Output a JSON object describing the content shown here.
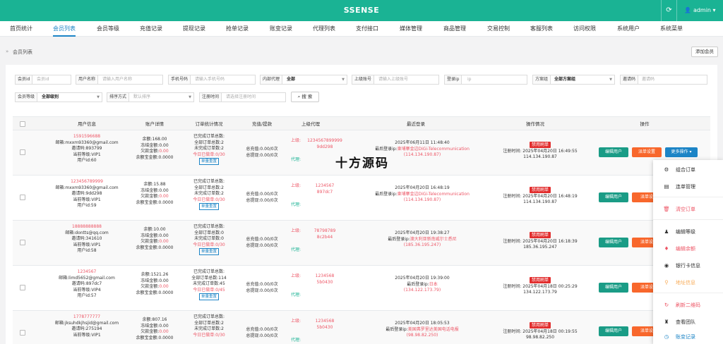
{
  "app": {
    "title": "SSENSE",
    "user": "admin"
  },
  "nav": [
    "首页统计",
    "会员列表",
    "会员等级",
    "充值记录",
    "提现记录",
    "抢单记录",
    "账变记录",
    "代理列表",
    "支付接口",
    "媒体管理",
    "商品管理",
    "交易控制",
    "客服列表",
    "访问权限",
    "系统用户",
    "系统菜单"
  ],
  "breadcrumb": {
    "label": "会员列表",
    "add_button": "添加会员"
  },
  "filters": {
    "userid": {
      "label": "会员id",
      "placeholder": "会员id"
    },
    "username": {
      "label": "用户名称",
      "placeholder": "请输入用户名称"
    },
    "phone": {
      "label": "手机号码",
      "placeholder": "请输入手机号码"
    },
    "agent": {
      "label": "内部代理",
      "value": "全部"
    },
    "superior": {
      "label": "上级账号",
      "placeholder": "请输入上级账号"
    },
    "ip": {
      "label": "登录ip",
      "placeholder": "ip"
    },
    "scheme": {
      "label": "方案组",
      "value": "全部方案组"
    },
    "invite": {
      "label": "邀请码",
      "placeholder": "邀请码"
    },
    "level": {
      "label": "会员等级",
      "value": "全部级别"
    },
    "sort": {
      "label": "排序方式",
      "placeholder": "默认排序"
    },
    "regtime": {
      "label": "注册时间",
      "placeholder": "请选择注册时间"
    },
    "search_button": "搜 索"
  },
  "table": {
    "headers": [
      "用户信息",
      "账户详情",
      "订单统计情况",
      "充值/提款",
      "上级代理",
      "最近登录",
      "操作情况",
      "操作"
    ],
    "rows": [
      {
        "phone": "1591596688",
        "email": "邮箱:mxxm93360@gmail.com",
        "invite": "邀请码:893799",
        "level": "当前等级:VIP1",
        "pid": "用户id:60",
        "balance": "余额:168.00",
        "frozen": "冻结金额:0.00",
        "owed_label": "欠款金额:",
        "owed_val": "0.00",
        "yeb": "余额宝金额:0.0000",
        "o1": "已完成订单总数:",
        "o2": "全部订单总数:2",
        "o3": "未完成订单数:2",
        "o4": "今日已做单:0/30",
        "o5": "单量重置",
        "dep": "总充值:0.00/0次",
        "wd": "总提现:0.00/0次",
        "sup_label": "上级:",
        "sup_val": "1234567899999\n9dd298",
        "agent_label": "代理:",
        "l1": "2025年06月11日 11:48:40",
        "l2_label": "最后登录ip:",
        "l2_val": "柬埔寨金边DiGi-Telecommunication",
        "l3": "(114.134.190.87)",
        "ban": "禁用刷单",
        "reg": "注册时间: 2025年04月20日 16:49:55",
        "ip": "114.134.190.87",
        "edit": "编辑用户",
        "setting": "派单设置",
        "more": "更多操作 ▾"
      },
      {
        "phone": "123456789999",
        "email": "邮箱:mxxm93360@gmail.com",
        "invite": "邀请码:9dd298",
        "level": "当前等级:VIP1",
        "pid": "用户id:59",
        "balance": "余额:15.88",
        "frozen": "冻结金额:0.00",
        "owed_label": "欠款金额:",
        "owed_val": "0.00",
        "yeb": "余额宝金额:0.0000",
        "o1": "已完成订单总数:",
        "o2": "全部订单总数:2",
        "o3": "未完成订单数:2",
        "o4": "今日已做单:0/30",
        "o5": "单量重置",
        "dep": "总充值:0.00/0次",
        "wd": "总提现:0.00/0次",
        "sup_label": "上级:",
        "sup_val": "1234567\n897dc7",
        "agent_label": "代理:",
        "l1": "2025年04月20日 16:48:19",
        "l2_label": "最后登录ip:",
        "l2_val": "柬埔寨金边DiGi-Telecommunication",
        "l3": "(114.134.190.87)",
        "ban": "禁用刷单",
        "reg": "注册时间: 2025年04月20日 16:48:19",
        "ip": "114.134.190.87",
        "edit": "编辑用户",
        "setting": "派单设",
        "more": ""
      },
      {
        "phone": "18888888888",
        "email": "邮箱:dontts@qq.com",
        "invite": "邀请码:341610",
        "level": "当前等级:VIP1",
        "pid": "用户id:58",
        "balance": "余额:10.00",
        "frozen": "冻结金额:0.00",
        "owed_label": "欠款金额:",
        "owed_val": "0.00",
        "yeb": "余额宝金额:0.0000",
        "o1": "已完成订单总数:",
        "o2": "全部订单总数:0",
        "o3": "未完成订单数:0",
        "o4": "今日已做单:0/30",
        "o5": "单量重置",
        "dep": "总充值:0.00/0次",
        "wd": "总提现:0.00/0次",
        "sup_label": "上级:",
        "sup_val": "78798789\n8c2b44",
        "agent_label": "代理:",
        "l1": "2025年04月20日 19:38:27",
        "l2_label": "最后登录ip:",
        "l2_val": "澳大利亚新南威尔士悉尼",
        "l3": "(185.36.195.247)",
        "ban": "禁用刷单",
        "reg": "注册时间: 2025年04月20日 16:18:39",
        "ip": "185.36.195.247",
        "edit": "编辑用户",
        "setting": "派单设",
        "more": ""
      },
      {
        "phone": "1234567",
        "email": "邮箱:limd5652@gmail.com",
        "invite": "邀请码:897dc7",
        "level": "当前等级:VIP4",
        "pid": "用户id:57",
        "balance": "余额:1521.26",
        "frozen": "冻结金额:0.00",
        "owed_label": "欠款金额:",
        "owed_val": "0.00",
        "yeb": "余额宝金额:0.0000",
        "o1": "已完成订单总数:",
        "o2": "全部订单总数:114",
        "o3": "未完成订单数:45",
        "o4": "今日已做单:0/45",
        "o5": "单量重置",
        "dep": "总充值:0.00/0次",
        "wd": "总提现:0.00/0次",
        "sup_label": "上级:",
        "sup_val": "1234568\n5b0430",
        "agent_label": "代理:",
        "l1": "2025年04月20日 19:39:00",
        "l2_label": "最后登录ip:",
        "l2_val": "日本",
        "l3": "(134.122.173.79)",
        "ban": "禁用刷单",
        "reg": "注册时间: 2025年04月18日 00:25:29",
        "ip": "134.122.173.79",
        "edit": "编辑用户",
        "setting": "派单设",
        "more": ""
      },
      {
        "phone": "1778777777",
        "email": "邮箱:jksuhdkjhsjid@gmail.com",
        "invite": "邀请码:275194",
        "level": "当前等级:VIP1",
        "pid": "",
        "balance": "余额:807.16",
        "frozen": "冻结金额:0.00",
        "owed_label": "欠款金额:",
        "owed_val": "0.00",
        "yeb": "余额宝金额:0.0000",
        "o1": "已完成订单总数:",
        "o2": "全部订单总数:2",
        "o3": "未完成订单数:2",
        "o4": "今日已做单:0/30",
        "o5": "",
        "dep": "总充值:0.00/0次",
        "wd": "总提现:0.00/0次",
        "sup_label": "上级:",
        "sup_val": "1234568\n5b0430",
        "agent_label": "代理:",
        "l1": "2025年04月20日 18:05:53",
        "l2_label": "最后登录ip:",
        "l2_val": "美国弗罗里达美国电话电报",
        "l3": "(98.98.82.250)",
        "ban": "禁用刷单",
        "reg": "注册时间: 2025年04月18日 00:19:55",
        "ip": "98.98.82.250",
        "edit": "编辑用户",
        "setting": "派单设",
        "more": ""
      }
    ]
  },
  "watermark": "十方源码",
  "dropdown": [
    {
      "label": "组合订单",
      "icon": "⚙",
      "color": "#333"
    },
    {
      "label": "连单管理",
      "icon": "▤",
      "color": "#333"
    },
    {
      "label": "清空订单",
      "icon": "🗑",
      "color": "#ed5565"
    },
    {
      "label": "编辑等级",
      "icon": "♟",
      "color": "#333"
    },
    {
      "label": "编辑余额",
      "icon": "♦",
      "color": "#ed5565"
    },
    {
      "label": "银行卡信息",
      "icon": "◉",
      "color": "#333"
    },
    {
      "label": "地址信息",
      "icon": "⚲",
      "color": "#f8ac59"
    },
    {
      "label": "刷新二维码",
      "icon": "↻",
      "color": "#ed5565"
    },
    {
      "label": "查看团队",
      "icon": "♜",
      "color": "#333"
    },
    {
      "label": "账变记录",
      "icon": "◷",
      "color": "#1c84c6"
    }
  ]
}
